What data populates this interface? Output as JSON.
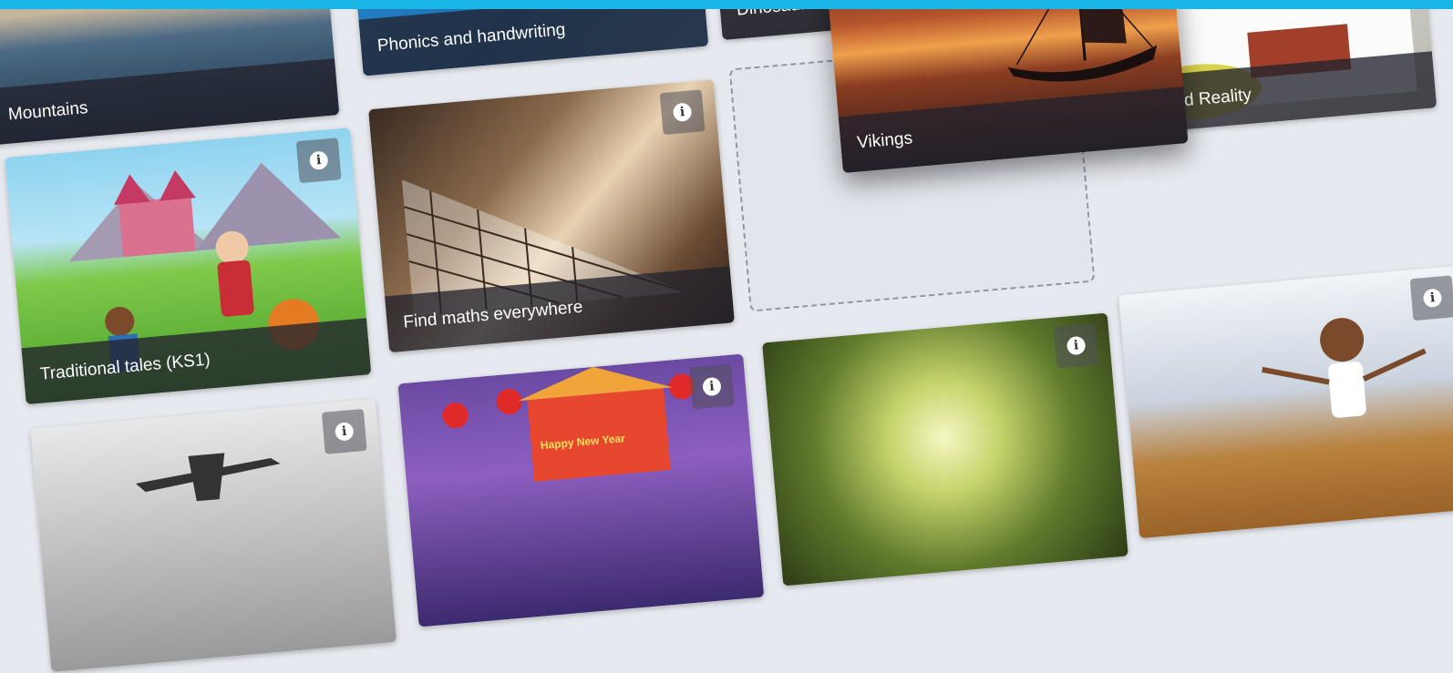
{
  "header": {
    "accent_color": "#1ab6e8"
  },
  "tiles": {
    "mountains": {
      "title": "Mountains"
    },
    "phonics": {
      "title": "Phonics and handwriting"
    },
    "dinosaurs": {
      "title": "Dinosaurs"
    },
    "vikings": {
      "title": "Vikings"
    },
    "traditional_tales": {
      "title": "Traditional tales (KS1)"
    },
    "find_maths": {
      "title": "Find maths everywhere"
    },
    "augmented_reality": {
      "title": "Augmented Reality"
    },
    "ww2": {
      "title": ""
    },
    "chinese_new_year": {
      "title": "",
      "banner_text": "Happy New Year"
    },
    "forest": {
      "title": ""
    },
    "sports_hall": {
      "title": ""
    }
  },
  "icons": {
    "info_glyph": "i"
  }
}
